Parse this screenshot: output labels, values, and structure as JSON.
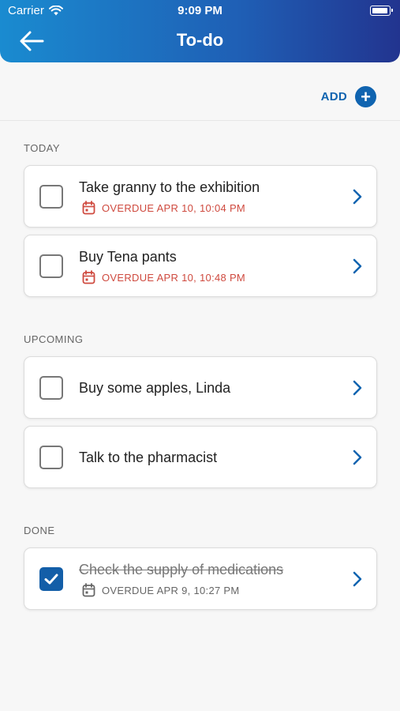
{
  "status_bar": {
    "carrier": "Carrier",
    "time": "9:09 PM"
  },
  "header": {
    "title": "To-do",
    "back_icon": "arrow-left-icon"
  },
  "actions": {
    "add_label": "ADD",
    "add_icon": "plus-circle-icon"
  },
  "colors": {
    "accent": "#1064b0",
    "overdue": "#cf4a3f",
    "header_start": "#1a8bd0",
    "header_end": "#22348f"
  },
  "sections": {
    "today": {
      "title": "TODAY",
      "items": [
        {
          "title": "Take granny to the exhibition",
          "due": "OVERDUE APR 10, 10:04 PM",
          "checked": false
        },
        {
          "title": "Buy Tena pants",
          "due": "OVERDUE APR 10, 10:48 PM",
          "checked": false
        }
      ]
    },
    "upcoming": {
      "title": "UPCOMING",
      "items": [
        {
          "title": "Buy some apples, Linda",
          "checked": false
        },
        {
          "title": "Talk to the pharmacist",
          "checked": false
        }
      ]
    },
    "done": {
      "title": "DONE",
      "items": [
        {
          "title": "Check the supply of medications",
          "due": "OVERDUE APR 9, 10:27 PM",
          "checked": true
        }
      ]
    }
  }
}
